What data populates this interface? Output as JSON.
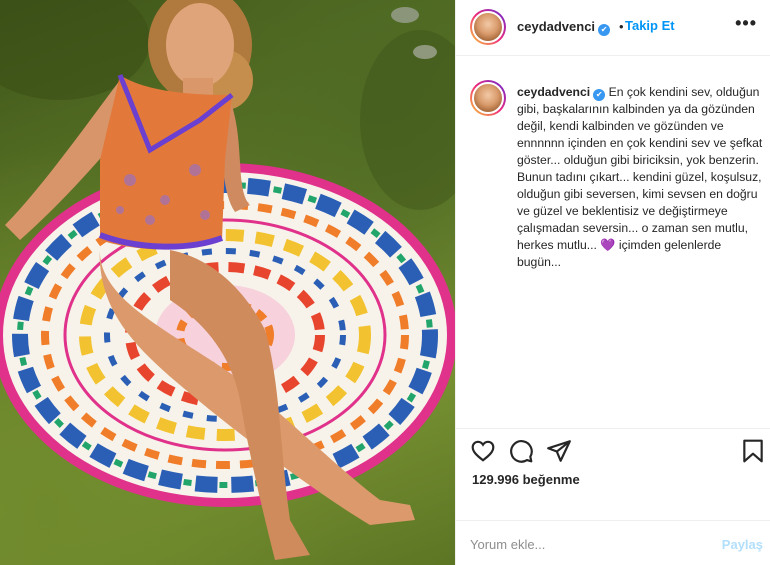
{
  "header": {
    "username": "ceydadvenci",
    "verified_mark": "✔",
    "separator": "•",
    "follow_label": "Takip Et",
    "more_label": "•••"
  },
  "caption": {
    "username": "ceydadvenci",
    "verified_mark": "✔",
    "text_part1": "En çok kendini sev, olduğun gibi, başkalarının kalbinden ya da gözünden değil, kendi kalbinden ve gözünden ve ennnnnn içinden en çok kendini sev ve şefkat göster... olduğun gibi biriciksin, yok benzerin. Bunun tadını çıkart... kendini güzel, koşulsuz, olduğun gibi seversen, kimi sevsen en doğru ve güzel ve beklentisiz ve değiştirmeye çalışmadan seversin... o zaman sen mutlu, herkes mutlu... ",
    "emoji": "💜",
    "text_part2": " içimden gelenlerde bugün..."
  },
  "actions": {
    "like_icon": "heart-outline-icon",
    "comment_icon": "comment-bubble-icon",
    "share_icon": "paper-plane-icon",
    "save_icon": "bookmark-icon"
  },
  "likes": {
    "text": "129.996 beğenme"
  },
  "comment": {
    "placeholder": "Yorum ekle...",
    "post_label": "Paylaş"
  },
  "colors": {
    "accent": "#0095f6",
    "post_disabled": "#b2dffc",
    "verified": "#3897f0"
  }
}
